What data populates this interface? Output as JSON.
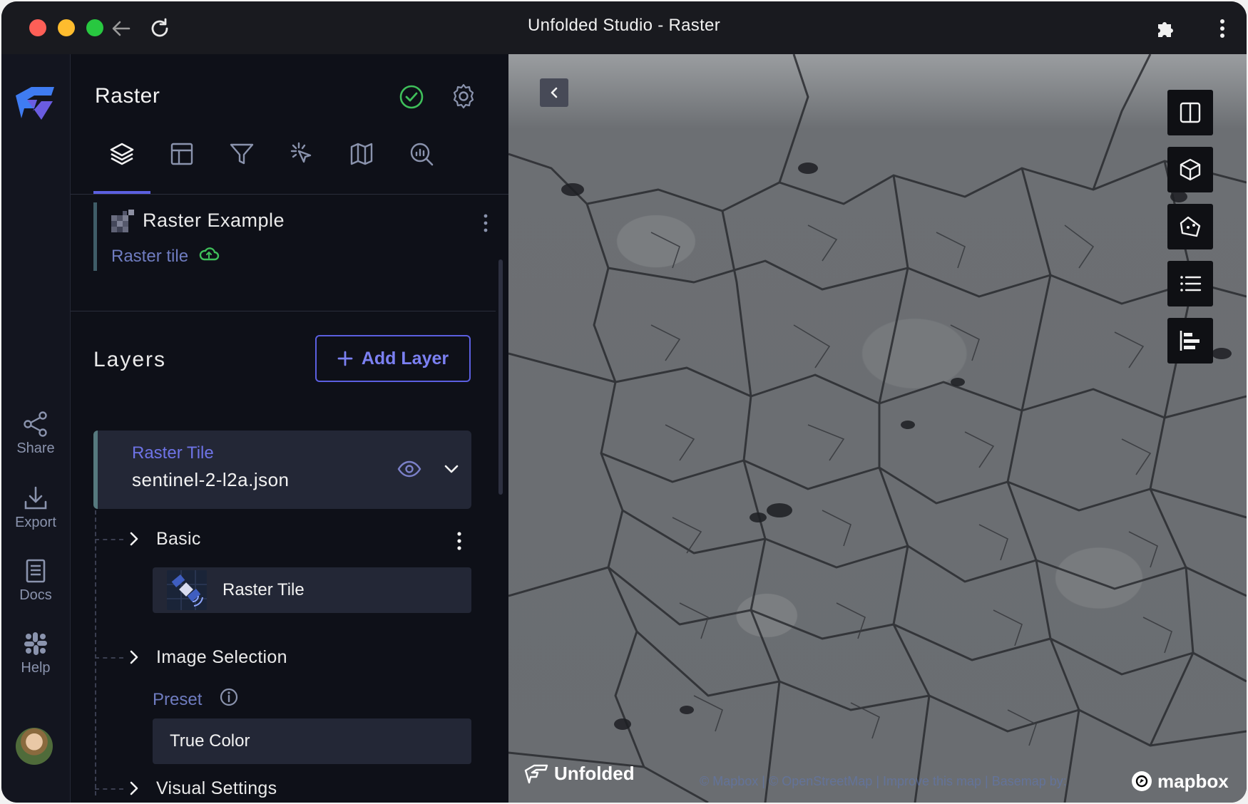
{
  "window": {
    "title": "Unfolded Studio - Raster"
  },
  "rail": {
    "items": [
      {
        "label": "Share",
        "icon": "share-icon"
      },
      {
        "label": "Export",
        "icon": "export-icon"
      },
      {
        "label": "Docs",
        "icon": "docs-icon"
      },
      {
        "label": "Help",
        "icon": "help-icon"
      }
    ]
  },
  "panel": {
    "title": "Raster",
    "tabs": [
      "layers-icon",
      "table-icon",
      "filter-icon",
      "interaction-icon",
      "basemap-icon",
      "analysis-icon"
    ],
    "active_tab": 0,
    "dataset": {
      "name": "Raster Example",
      "type": "Raster tile"
    },
    "layers_title": "Layers",
    "add_layer_label": "Add Layer",
    "layer": {
      "type": "Raster Tile",
      "name": "sentinel-2-l2a.json",
      "sections": {
        "basic": "Basic",
        "layer_type": "Raster Tile",
        "image_selection": "Image Selection",
        "preset_label": "Preset",
        "preset_value": "True Color",
        "visual_settings": "Visual Settings"
      }
    }
  },
  "map": {
    "brand": "Unfolded",
    "attribution": "© Mapbox | © OpenStreetMap | Improve this map | Basemap by:",
    "basemap_brand": "mapbox",
    "tools": [
      "split-map-icon",
      "3d-cube-icon",
      "draw-polygon-icon",
      "legend-icon",
      "layer-order-icon"
    ]
  },
  "colors": {
    "accent": "#5b5fe0",
    "success": "#3fbf5a",
    "panel_bg": "#0e1018"
  }
}
